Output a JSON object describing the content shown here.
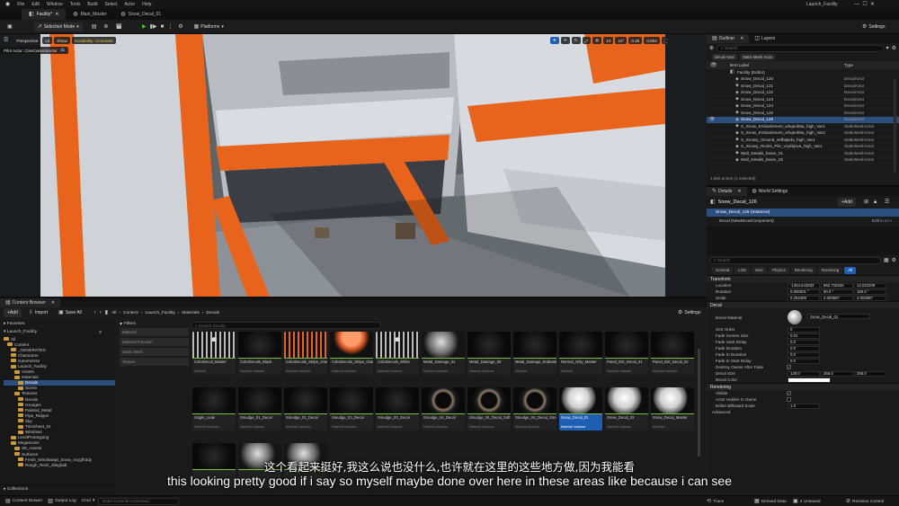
{
  "menubar": {
    "items": [
      "File",
      "Edit",
      "Window",
      "Tools",
      "Build",
      "Select",
      "Actor",
      "Help"
    ],
    "project_name": "Launch_Facility"
  },
  "doc_tabs": [
    {
      "label": "Facility*",
      "active": true
    },
    {
      "label": "Main_Master",
      "active": false
    },
    {
      "label": "Snow_Decal_01",
      "active": false
    }
  ],
  "toolbar": {
    "mode_label": "Selection Mode",
    "platforms_label": "Platforms",
    "settings_label": "Settings"
  },
  "viewport": {
    "perspective_label": "Perspective",
    "lit_label": "Lit",
    "show_label": "Show",
    "scalability_label": "Scalability: Cinematic",
    "pilot_label": "Pilot Actor: CineCameraActor",
    "grid_value": "10",
    "angle_value": "10°",
    "scale_value": "0.25",
    "speed_value": "0.904"
  },
  "outliner": {
    "tab_outliner": "Outliner",
    "tab_layers": "Layers",
    "search_placeholder": "Search",
    "filter_chips": [
      "Decal Actor",
      "Static Mesh Actor"
    ],
    "col_label": "Item Label",
    "col_type": "Type",
    "rows": [
      {
        "label": "Facility (Editor)",
        "type": "",
        "selected": false
      },
      {
        "label": "Snow_Decal_120",
        "type": "DecalActor",
        "selected": false
      },
      {
        "label": "Snow_Decal_121",
        "type": "DecalActor",
        "selected": false
      },
      {
        "label": "Snow_Decal_122",
        "type": "DecalActor",
        "selected": false
      },
      {
        "label": "Snow_Decal_123",
        "type": "DecalActor",
        "selected": false
      },
      {
        "label": "Snow_Decal_124",
        "type": "DecalActor",
        "selected": false
      },
      {
        "label": "Snow_Decal_125",
        "type": "DecalActor",
        "selected": false
      },
      {
        "label": "Snow_Decal_126",
        "type": "DecalActor",
        "selected": true
      },
      {
        "label": "S_Snow_Embankment_whqeob5a_high_Var1",
        "type": "StaticMeshActor",
        "selected": false
      },
      {
        "label": "S_Snow_Embankment_whqeob5a_high_Var2",
        "type": "StaticMeshActor",
        "selected": false
      },
      {
        "label": "S_Snowy_Ground_vefbajsda_high_Var1",
        "type": "StaticMeshActor",
        "selected": false
      },
      {
        "label": "S_Snowy_Rocks_Pile_vcykbjsva_high_Var1",
        "type": "StaticMeshActor",
        "selected": false
      },
      {
        "label": "Wall_Details_beam_01",
        "type": "StaticMeshActor",
        "selected": false
      },
      {
        "label": "Wall_Details_beam_02",
        "type": "StaticMeshActor",
        "selected": false
      }
    ],
    "count_text": "1,550 actors (1 selected)"
  },
  "details": {
    "tab_details": "Details",
    "tab_world": "World Settings",
    "actor_name": "Snow_Decal_126",
    "add_label": "+Add",
    "instance_label": "Snow_Decal_126 (Instance)",
    "component_label": "Decal (NewDecalComponent)",
    "edit_in_cpp": "Edit in C++",
    "search_placeholder": "Search",
    "filter_tabs": [
      "General",
      "LOD",
      "Misc",
      "Physics",
      "Rendering",
      "Streaming",
      "All"
    ],
    "transform_header": "Transform",
    "location_label": "Location",
    "location_values": [
      "-1364.543832",
      "862.718346",
      "14.022209"
    ],
    "rotation_label": "Rotation",
    "rotation_values": [
      "0.000001 °",
      "90.0 °",
      "180.0 °"
    ],
    "scale_label": "Scale",
    "scale_values": [
      "0.252409",
      "2.003687",
      "2.003687"
    ],
    "decal_header": "Decal",
    "decal_material_label": "Decal Material",
    "decal_material_value": "Snow_Decal_01",
    "props": [
      {
        "label": "Sort Order",
        "value": "0"
      },
      {
        "label": "Fade Screen Size",
        "value": "0.01"
      },
      {
        "label": "Fade Start Delay",
        "value": "0.0"
      },
      {
        "label": "Fade Duration",
        "value": "0.0"
      },
      {
        "label": "Fade In Duration",
        "value": "0.0"
      },
      {
        "label": "Fade In Start Delay",
        "value": "0.0"
      }
    ],
    "destroy_owner_label": "Destroy Owner After Fade",
    "decal_size_label": "Decal Size",
    "decal_size_values": [
      "128.0",
      "256.0",
      "256.0"
    ],
    "decal_color_label": "Decal Color",
    "rendering_header": "Rendering",
    "visible_label": "Visible",
    "hidden_in_game_label": "Actor Hidden In Game",
    "billboard_label": "Editor Billboard Scale",
    "billboard_value": "1.0",
    "advanced_label": "Advanced"
  },
  "content_browser": {
    "title": "Content Browser",
    "add_label": "+Add",
    "import_label": "Import",
    "save_all_label": "Save All",
    "breadcrumb": [
      "All",
      "Content",
      "Launch_Facility",
      "Materials",
      "Decals"
    ],
    "settings_label": "Settings",
    "favorites_label": "Favorites",
    "project_label": "Launch_Facility",
    "filters_label": "Filters",
    "search_placeholder": "Search Decals",
    "filter_items": [
      "Material",
      "Material Function",
      "Static Mesh",
      "Texture"
    ],
    "tree": [
      {
        "label": "All",
        "depth": 0,
        "selected": false
      },
      {
        "label": "Content",
        "depth": 1,
        "selected": false
      },
      {
        "label": "_GENERATED",
        "depth": 2,
        "selected": false
      },
      {
        "label": "Characters",
        "depth": 2,
        "selected": false
      },
      {
        "label": "GameVerse",
        "depth": 2,
        "selected": false
      },
      {
        "label": "Launch_Facility",
        "depth": 2,
        "selected": false
      },
      {
        "label": "Assets",
        "depth": 3,
        "selected": false
      },
      {
        "label": "Materials",
        "depth": 3,
        "selected": false
      },
      {
        "label": "Decals",
        "depth": 4,
        "selected": true
      },
      {
        "label": "Scene",
        "depth": 4,
        "selected": false
      },
      {
        "label": "Textures",
        "depth": 3,
        "selected": false
      },
      {
        "label": "Decals",
        "depth": 4,
        "selected": false
      },
      {
        "label": "Grunges",
        "depth": 4,
        "selected": false
      },
      {
        "label": "Painted_Metal",
        "depth": 4,
        "selected": false
      },
      {
        "label": "Pipe_Ridges",
        "depth": 4,
        "selected": false
      },
      {
        "label": "Sky",
        "depth": 4,
        "selected": false
      },
      {
        "label": "TrimSheet_01",
        "depth": 4,
        "selected": false
      },
      {
        "label": "Windows",
        "depth": 4,
        "selected": false
      },
      {
        "label": "LevelPrototyping",
        "depth": 2,
        "selected": false
      },
      {
        "label": "Megascans",
        "depth": 2,
        "selected": false
      },
      {
        "label": "3D_Assets",
        "depth": 3,
        "selected": false
      },
      {
        "label": "Surfaces",
        "depth": 3,
        "selected": false
      },
      {
        "label": "Fresh_Windswept_Snow_vcygfh3dy",
        "depth": 4,
        "selected": false
      },
      {
        "label": "Rough_Rock_xbkgbab",
        "depth": 4,
        "selected": false
      }
    ],
    "collections_label": "Collections",
    "assets": [
      {
        "name": "ColorDecal_Master",
        "type": "Material",
        "thumb": "chain",
        "selected": false
      },
      {
        "name": "ColorDecals_Black",
        "type": "Material Instance",
        "thumb": "dark",
        "selected": false
      },
      {
        "name": "ColorDecals_Stripe_Orange",
        "type": "Material Instance",
        "thumb": "orange-chain",
        "selected": false
      },
      {
        "name": "ColorDecals_Stripe_Orange",
        "type": "Material Instance",
        "thumb": "orange-sphere",
        "selected": false
      },
      {
        "name": "ColorDecals_White",
        "type": "Material Instance",
        "thumb": "chain",
        "selected": false
      },
      {
        "name": "Metal_Damage_01",
        "type": "Material Instance",
        "thumb": "grey-sphere",
        "selected": false
      },
      {
        "name": "Metal_Damage_03",
        "type": "Material Instance",
        "thumb": "dark",
        "selected": false
      },
      {
        "name": "Metal_Damage_Embankment_Master",
        "type": "Material",
        "thumb": "dark",
        "selected": false
      },
      {
        "name": "Normal_Only_Master",
        "type": "Material",
        "thumb": "dark",
        "selected": false
      },
      {
        "name": "Panel_Dirt_Decal_01",
        "type": "Material Instance",
        "thumb": "dark",
        "selected": false
      },
      {
        "name": "Panel_Dirt_Decal_02",
        "type": "Material Instance",
        "thumb": "dark",
        "selected": false
      },
      {
        "name": "Single_Leak",
        "type": "Material Instance",
        "thumb": "dark",
        "selected": false
      },
      {
        "name": "Smudge_01_Decal",
        "type": "Material Instance",
        "thumb": "dark",
        "selected": false
      },
      {
        "name": "Smudge_02_Decal",
        "type": "Material Instance",
        "thumb": "dark",
        "selected": false
      },
      {
        "name": "Smudge_03_Decal",
        "type": "Material Instance",
        "thumb": "dark",
        "selected": false
      },
      {
        "name": "Smudge_03_Decal",
        "type": "Material Instance",
        "thumb": "dark",
        "selected": false
      },
      {
        "name": "Smudge_04_Decal",
        "type": "Material Instance",
        "thumb": "ring",
        "selected": false
      },
      {
        "name": "Smudge_04_Decal_Soft",
        "type": "Material Instance",
        "thumb": "ring",
        "selected": false
      },
      {
        "name": "Smudge_04_Decal_Strong",
        "type": "Material Instance",
        "thumb": "ring",
        "selected": false
      },
      {
        "name": "Snow_Decal_01",
        "type": "Material Instance",
        "thumb": "snow",
        "selected": true
      },
      {
        "name": "Snow_Decal_02",
        "type": "Material Instance",
        "thumb": "snow",
        "selected": false
      },
      {
        "name": "Snow_Decal_Master",
        "type": "Material",
        "thumb": "snow",
        "selected": false
      },
      {
        "name": "",
        "type": "",
        "thumb": "dark",
        "selected": false
      },
      {
        "name": "",
        "type": "",
        "thumb": "grey-sphere",
        "selected": false
      },
      {
        "name": "",
        "type": "",
        "thumb": "grey-sphere",
        "selected": false
      }
    ]
  },
  "statusbar": {
    "content_drawer": "Content Drawer",
    "output_log": "Output Log",
    "cmd_label": "Cmd",
    "console_placeholder": "Enter Console Command",
    "trace_label": "Trace",
    "derived_data_label": "Derived Data",
    "unsaved_label": "4 Unsaved",
    "revision_label": "Revision Control"
  },
  "subtitles": {
    "zh": "这个看起来挺好,我这么说也没什么,也许就在这里的这些地方做,因为我能看",
    "en": "this looking pretty good if i say so myself maybe done over here in these areas like because i can see"
  },
  "colors": {
    "accent": "#1e5fb3",
    "orange": "#e8641c",
    "selection": "#2b4e7d",
    "play": "#4fbf3a"
  }
}
